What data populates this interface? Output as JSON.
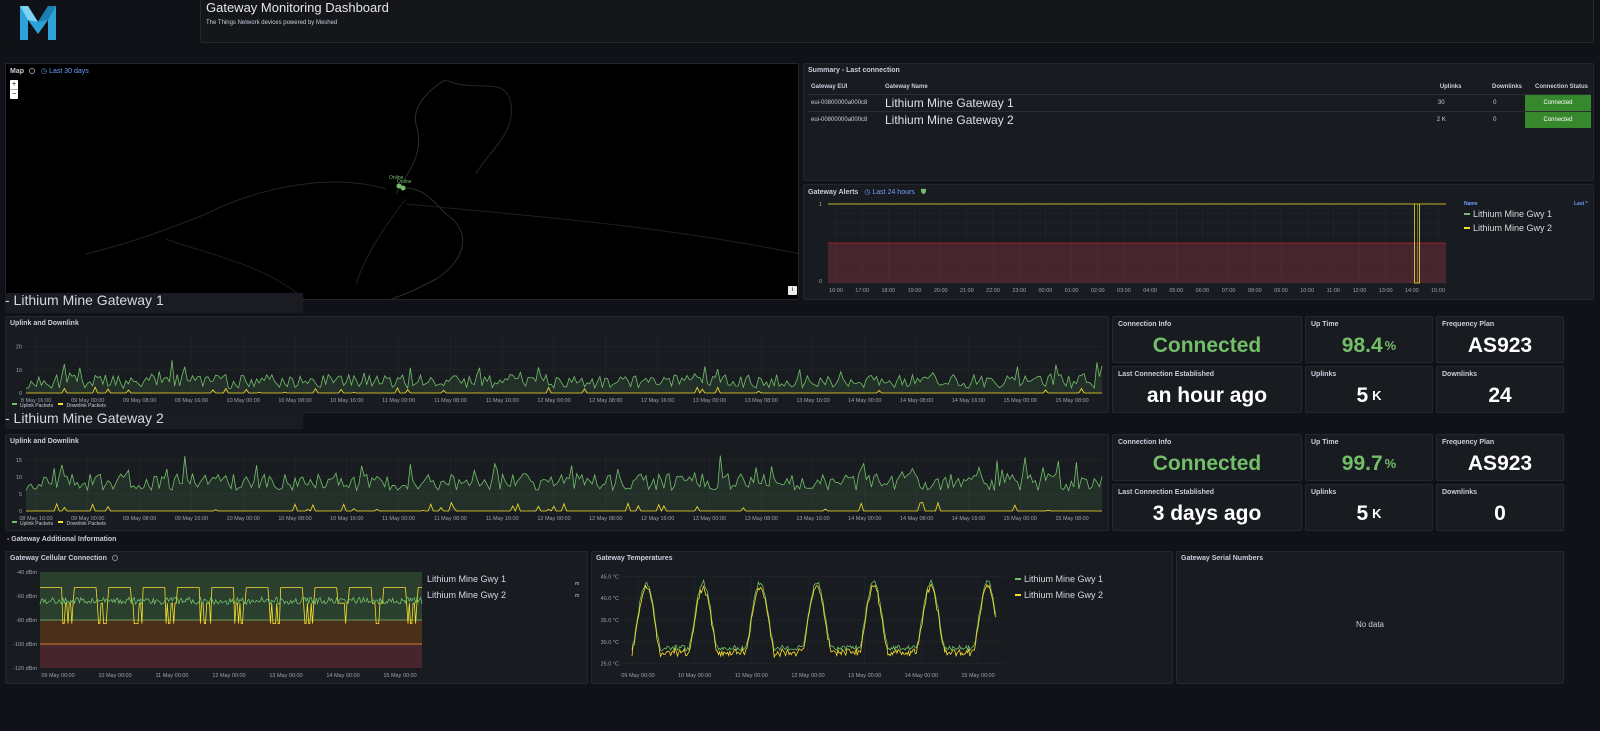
{
  "header": {
    "logo_label": "Meshed logo",
    "title": "Gateway Monitoring Dashboard",
    "subtitle": "The Things Network devices powered by Meshed"
  },
  "map": {
    "title": "Map",
    "time_range": "Last 30 days",
    "zoom_in": "+",
    "zoom_out": "−",
    "marker_label": "Online",
    "marker_label_2": "Online",
    "attribution": "i"
  },
  "summary": {
    "title": "Summary - Last connection",
    "columns": [
      "Gateway EUI",
      "Gateway Name",
      "Uplinks",
      "Downlinks",
      "Connection Status"
    ],
    "rows": [
      {
        "eui": "eui-00800000a000c8",
        "name": "Lithium Mine Gateway 1",
        "uplinks": "30",
        "downlinks": "0",
        "status": "Connected"
      },
      {
        "eui": "eui-00800000a000c8",
        "name": "Lithium Mine Gateway 2",
        "uplinks": "2 K",
        "downlinks": "0",
        "status": "Connected"
      }
    ]
  },
  "alerts": {
    "title": "Gateway Alerts",
    "time_range": "Last 24 hours",
    "legend_header_name": "Name",
    "legend_header_last": "Last *",
    "series": [
      {
        "name": "Lithium Mine Gwy 1",
        "color": "#73bf69"
      },
      {
        "name": "Lithium Mine Gwy 2",
        "color": "#fade2a"
      }
    ],
    "y_ticks": [
      "1",
      "0"
    ],
    "x_ticks": [
      "16:00",
      "17:00",
      "18:00",
      "19:00",
      "20:00",
      "21:00",
      "22:00",
      "23:00",
      "00:00",
      "01:00",
      "02:00",
      "03:00",
      "04:00",
      "05:00",
      "06:00",
      "07:00",
      "08:00",
      "09:00",
      "10:00",
      "11:00",
      "12:00",
      "13:00",
      "14:00",
      "15:00"
    ]
  },
  "sections": {
    "gw1": "- Lithium Mine Gateway 1",
    "gw2": "- Lithium Mine Gateway 2",
    "additional": "- Gateway Additional Information"
  },
  "gw1": {
    "chart_title": "Uplink and Downlink",
    "y_ticks": [
      "20",
      "10",
      "0"
    ],
    "x_ticks": [
      "8 May 16:00",
      "09 May 00:00",
      "09 May 08:00",
      "09 May 16:00",
      "10 May 00:00",
      "10 May 08:00",
      "10 May 16:00",
      "11 May 00:00",
      "11 May 08:00",
      "11 May 16:00",
      "12 May 00:00",
      "12 May 08:00",
      "12 May 16:00",
      "13 May 00:00",
      "13 May 08:00",
      "13 May 16:00",
      "14 May 00:00",
      "14 May 08:00",
      "14 May 16:00",
      "15 May 00:00",
      "15 May 08:00"
    ],
    "legend_up": "Uplink Packets",
    "legend_down": "Downlink Packets",
    "stats": {
      "conn_info_title": "Connection Info",
      "conn_info_value": "Connected",
      "uptime_title": "Up Time",
      "uptime_value": "98.4",
      "uptime_unit": "%",
      "freq_title": "Frequency Plan",
      "freq_value": "AS923",
      "last_title": "Last Connection Established",
      "last_value": "an hour ago",
      "uplinks_title": "Uplinks",
      "uplinks_value": "5",
      "uplinks_unit": "K",
      "downlinks_title": "Downlinks",
      "downlinks_value": "24"
    }
  },
  "gw2": {
    "chart_title": "Uplink and Downlink",
    "y_ticks": [
      "15",
      "10",
      "5",
      "0"
    ],
    "x_ticks": [
      "08 May 16:00",
      "09 May 00:00",
      "09 May 08:00",
      "09 May 16:00",
      "10 May 00:00",
      "10 May 08:00",
      "10 May 16:00",
      "11 May 00:00",
      "11 May 08:00",
      "11 May 16:00",
      "12 May 00:00",
      "12 May 08:00",
      "12 May 16:00",
      "13 May 00:00",
      "13 May 08:00",
      "13 May 16:00",
      "14 May 00:00",
      "14 May 08:00",
      "14 May 16:00",
      "15 May 00:00",
      "15 May 08:00"
    ],
    "legend_up": "Uplink Packets",
    "legend_down": "Downlink Packets",
    "stats": {
      "conn_info_title": "Connection Info",
      "conn_info_value": "Connected",
      "uptime_title": "Up Time",
      "uptime_value": "99.7",
      "uptime_unit": "%",
      "freq_title": "Frequency Plan",
      "freq_value": "AS923",
      "last_title": "Last Connection Established",
      "last_value": "3 days ago",
      "uplinks_title": "Uplinks",
      "uplinks_value": "5",
      "uplinks_unit": "K",
      "downlinks_title": "Downlinks",
      "downlinks_value": "0"
    }
  },
  "cellular": {
    "title": "Gateway Cellular Connection",
    "y_ticks": [
      "-40 dBm",
      "-60 dBm",
      "-80 dBm",
      "-100 dBm",
      "-120 dBm"
    ],
    "x_ticks": [
      "09 May 00:00",
      "10 May 00:00",
      "11 May 00:00",
      "12 May 00:00",
      "13 May 00:00",
      "14 May 00:00",
      "15 May 00:00"
    ],
    "legend": [
      {
        "name": "Lithium Mine Gwy 1",
        "color": "#73bf69",
        "value": "m"
      },
      {
        "name": "Lithium Mine Gwy 2",
        "color": "#fade2a",
        "value": "m"
      }
    ]
  },
  "temps": {
    "title": "Gateway Temperatures",
    "y_ticks": [
      "45.0 °C",
      "40.0 °C",
      "35.0 °C",
      "30.0 °C",
      "25.0 °C"
    ],
    "x_ticks": [
      "09 May 00:00",
      "10 May 00:00",
      "11 May 00:00",
      "12 May 00:00",
      "13 May 00:00",
      "14 May 00:00",
      "15 May 00:00"
    ],
    "legend": [
      {
        "name": "Lithium Mine Gwy 1",
        "color": "#73bf69"
      },
      {
        "name": "Lithium Mine Gwy 2",
        "color": "#fade2a"
      }
    ]
  },
  "serials": {
    "title": "Gateway Serial Numbers",
    "empty": "No data"
  }
}
